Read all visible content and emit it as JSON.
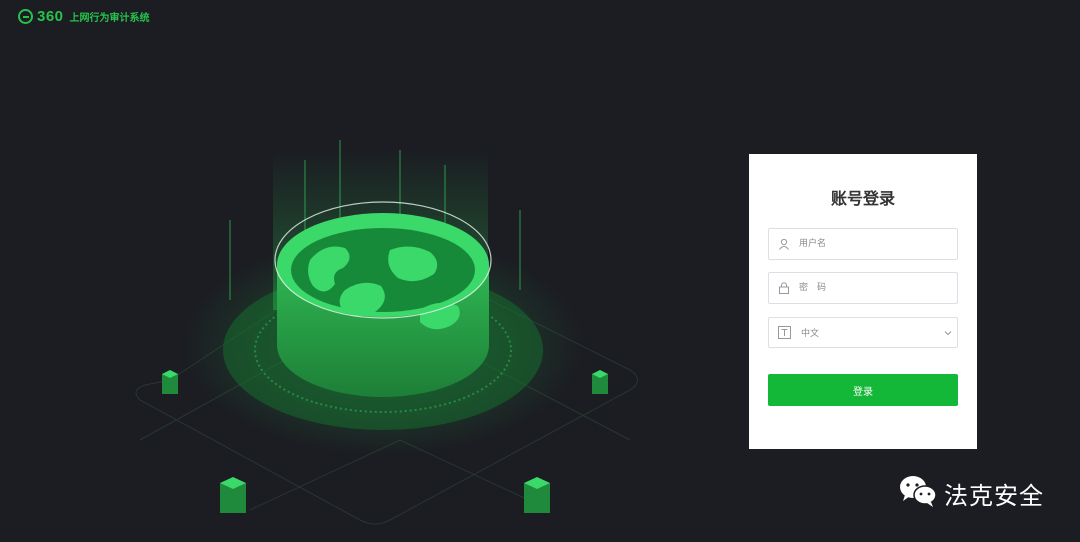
{
  "header": {
    "logo_number": "360",
    "product_name": "上网行为审计系统"
  },
  "login": {
    "title": "账号登录",
    "username_placeholder": "用户名",
    "password_placeholder": "密　码",
    "language_value": "中文",
    "submit_label": "登录"
  },
  "watermark": {
    "text": "法克安全"
  },
  "colors": {
    "background": "#1b1d22",
    "accent": "#13b838",
    "logo": "#27c24c"
  }
}
